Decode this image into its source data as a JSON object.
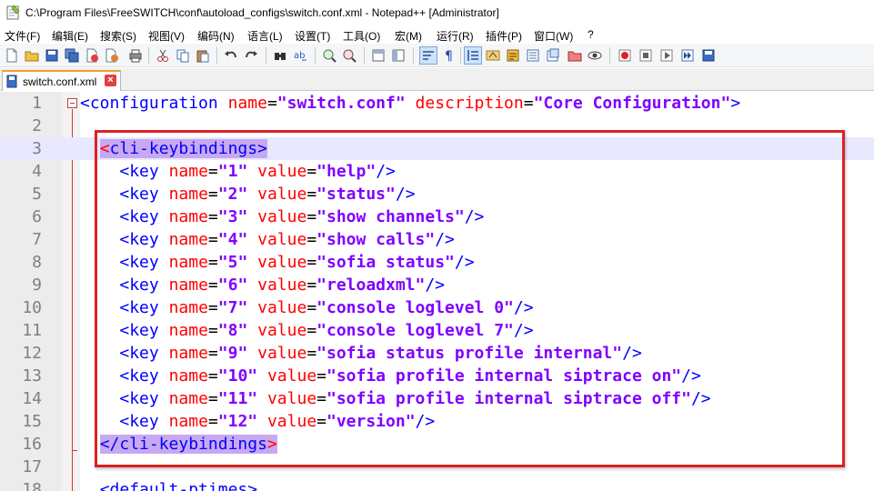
{
  "window": {
    "title": "C:\\Program Files\\FreeSWITCH\\conf\\autoload_configs\\switch.conf.xml - Notepad++ [Administrator]"
  },
  "menu": [
    "文件(F)",
    "编辑(E)",
    "搜索(S)",
    "视图(V)",
    "编码(N)",
    "语言(L)",
    "设置(T)",
    "工具(O)",
    "宏(M)",
    "运行(R)",
    "插件(P)",
    "窗口(W)",
    "?"
  ],
  "toolbar": {
    "icons": [
      "new-file-icon",
      "open-file-icon",
      "save-icon",
      "save-all-icon",
      "close-icon",
      "close-all-icon",
      "print-icon",
      "cut-icon",
      "copy-icon",
      "paste-icon",
      "undo-icon",
      "redo-icon",
      "find-icon",
      "replace-icon",
      "zoom-in-icon",
      "zoom-out-icon",
      "sync-v-icon",
      "sync-h-icon",
      "word-wrap-icon",
      "show-all-chars-icon",
      "indent-guide-icon",
      "udl-icon",
      "doc-map-icon",
      "func-list-icon",
      "folder-workspace-icon",
      "monitor-icon",
      "record-macro-icon",
      "stop-macro-icon",
      "play-macro-icon",
      "run-macro-icon",
      "save-macro-icon"
    ]
  },
  "tab": {
    "label": "switch.conf.xml",
    "close": "×"
  },
  "editor": {
    "lines": [
      {
        "n": "1"
      },
      {
        "n": "2"
      },
      {
        "n": "3"
      },
      {
        "n": "4"
      },
      {
        "n": "5"
      },
      {
        "n": "6"
      },
      {
        "n": "7"
      },
      {
        "n": "8"
      },
      {
        "n": "9"
      },
      {
        "n": "10"
      },
      {
        "n": "11"
      },
      {
        "n": "12"
      },
      {
        "n": "13"
      },
      {
        "n": "14"
      },
      {
        "n": "15"
      },
      {
        "n": "16"
      },
      {
        "n": "17"
      },
      {
        "n": "18"
      }
    ],
    "line1": {
      "open": "<",
      "tag": "configuration",
      "attr1": "name",
      "eq": "=",
      "val1": "\"switch.conf\"",
      "attr2": "description",
      "val2": "\"Core Configuration\"",
      "close": ">"
    },
    "line3": {
      "open": "<",
      "tag": "cli-keybindings",
      "close": ">"
    },
    "keys": [
      {
        "tag": "<key",
        "attr1": "name",
        "name": "\"1\"",
        "attr2": "value",
        "value": "\"help\"",
        "end": "/>"
      },
      {
        "tag": "<key",
        "attr1": "name",
        "name": "\"2\"",
        "attr2": "value",
        "value": "\"status\"",
        "end": "/>"
      },
      {
        "tag": "<key",
        "attr1": "name",
        "name": "\"3\"",
        "attr2": "value",
        "value": "\"show channels\"",
        "end": "/>"
      },
      {
        "tag": "<key",
        "attr1": "name",
        "name": "\"4\"",
        "attr2": "value",
        "value": "\"show calls\"",
        "end": "/>"
      },
      {
        "tag": "<key",
        "attr1": "name",
        "name": "\"5\"",
        "attr2": "value",
        "value": "\"sofia status\"",
        "end": "/>"
      },
      {
        "tag": "<key",
        "attr1": "name",
        "name": "\"6\"",
        "attr2": "value",
        "value": "\"reloadxml\"",
        "end": "/>"
      },
      {
        "tag": "<key",
        "attr1": "name",
        "name": "\"7\"",
        "attr2": "value",
        "value": "\"console loglevel 0\"",
        "end": "/>"
      },
      {
        "tag": "<key",
        "attr1": "name",
        "name": "\"8\"",
        "attr2": "value",
        "value": "\"console loglevel 7\"",
        "end": "/>"
      },
      {
        "tag": "<key",
        "attr1": "name",
        "name": "\"9\"",
        "attr2": "value",
        "value": "\"sofia status profile internal\"",
        "end": "/>"
      },
      {
        "tag": "<key",
        "attr1": "name",
        "name": "\"10\"",
        "attr2": "value",
        "value": "\"sofia profile internal siptrace on\"",
        "end": "/>"
      },
      {
        "tag": "<key",
        "attr1": "name",
        "name": "\"11\"",
        "attr2": "value",
        "value": "\"sofia profile internal siptrace off\"",
        "end": "/>"
      },
      {
        "tag": "<key",
        "attr1": "name",
        "name": "\"12\"",
        "attr2": "value",
        "value": "\"version\"",
        "end": "/>"
      }
    ],
    "line16": {
      "close_tag": "</cli-keybindings",
      "end": ">"
    },
    "line18": {
      "text": "<default-ptimes>"
    }
  },
  "colors": {
    "tag": "#0000ff",
    "attribute": "#ff0000",
    "value": "#8000ff",
    "annotation": "#e02020",
    "current_line": "#e8e8ff"
  }
}
